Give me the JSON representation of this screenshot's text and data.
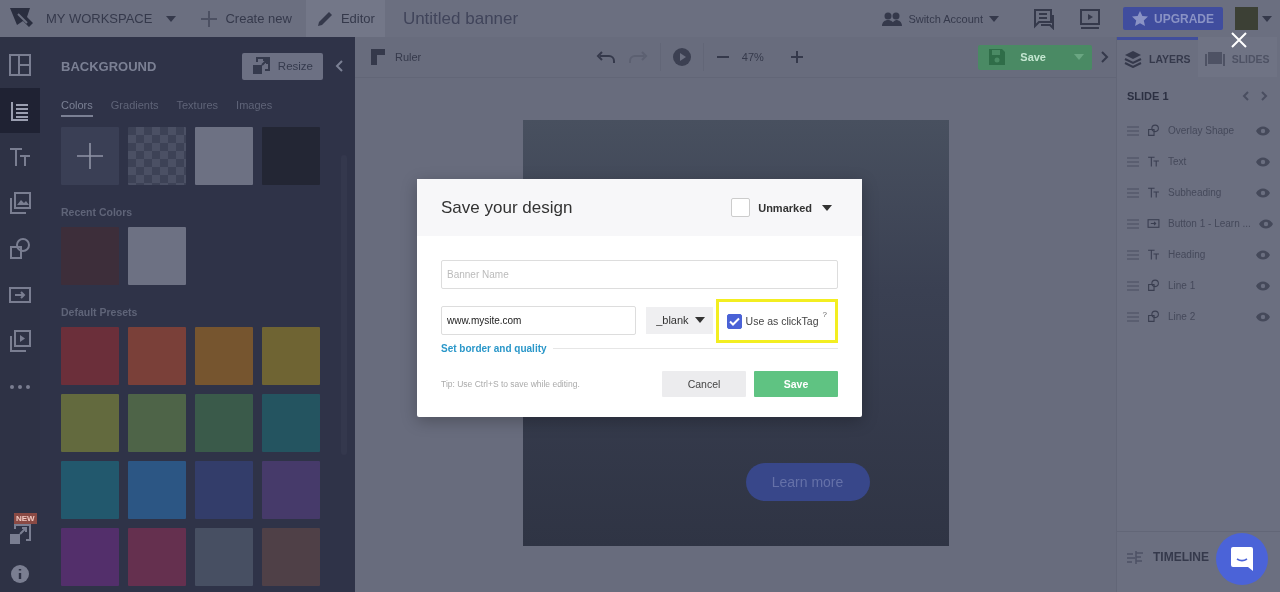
{
  "topbar": {
    "workspace": "MY WORKSPACE",
    "create": "Create new",
    "editor": "Editor",
    "title": "Untitled banner",
    "switch_account": "Switch Account",
    "upgrade": "UPGRADE"
  },
  "rail": [
    {
      "kind": "layout",
      "selected": false
    },
    {
      "kind": "background",
      "selected": true
    },
    {
      "kind": "text",
      "selected": false
    },
    {
      "kind": "image",
      "selected": false
    },
    {
      "kind": "shape",
      "selected": false
    },
    {
      "kind": "button",
      "selected": false
    },
    {
      "kind": "media",
      "selected": false
    },
    {
      "kind": "more",
      "selected": false
    }
  ],
  "rail_bottom": {
    "badge": "NEW"
  },
  "panel": {
    "title": "BACKGROUND",
    "resize": "Resize",
    "tabs": [
      {
        "label": "Colors",
        "selected": true
      },
      {
        "label": "Gradients",
        "selected": false
      },
      {
        "label": "Textures",
        "selected": false
      },
      {
        "label": "Images",
        "selected": false
      }
    ],
    "top_swatches": [
      {
        "kind": "add"
      },
      {
        "kind": "transparent"
      },
      {
        "kind": "color",
        "color": "#6d7183"
      },
      {
        "kind": "color",
        "color": "#232634"
      }
    ],
    "recent_title": "Recent Colors",
    "recent": [
      {
        "color": "#3d2e3a"
      },
      {
        "color": "#6d7183"
      }
    ],
    "presets_title": "Default Presets",
    "presets": [
      {
        "color": "#6b2f3a"
      },
      {
        "color": "#7a4039"
      },
      {
        "color": "#76552f"
      },
      {
        "color": "#6f6433"
      },
      {
        "color": "#636a3e"
      },
      {
        "color": "#4e6448"
      },
      {
        "color": "#3a5a4a"
      },
      {
        "color": "#245460"
      },
      {
        "color": "#22586d"
      },
      {
        "color": "#2c5684"
      },
      {
        "color": "#333d6a"
      },
      {
        "color": "#463a6a"
      },
      {
        "color": "#532f6b"
      },
      {
        "color": "#65304f"
      },
      {
        "color": "#474f62"
      },
      {
        "color": "#4f4047"
      }
    ]
  },
  "toolbar": {
    "ruler": "Ruler",
    "zoom": "47%",
    "save": "Save"
  },
  "canvas": {
    "button": "Learn more"
  },
  "right": {
    "tabs": [
      {
        "label": "LAYERS",
        "selected": true
      },
      {
        "label": "SLIDES",
        "selected": false
      }
    ],
    "slide": "SLIDE 1",
    "layers": [
      {
        "kind": "shape",
        "name": "Overlay Shape"
      },
      {
        "kind": "text",
        "name": "Text"
      },
      {
        "kind": "text",
        "name": "Subheading"
      },
      {
        "kind": "button",
        "name": "Button 1 - Learn ..."
      },
      {
        "kind": "text",
        "name": "Heading"
      },
      {
        "kind": "shape",
        "name": "Line 1"
      },
      {
        "kind": "shape",
        "name": "Line 2"
      }
    ],
    "timeline": "TIMELINE"
  },
  "dialog": {
    "title": "Save your design",
    "marker": {
      "checked": false,
      "label": "Unmarked"
    },
    "name_placeholder": "Banner Name",
    "url": "www.mysite.com",
    "target": "_blank",
    "clicktag": {
      "checked": true,
      "highlighted": true,
      "label": "Use as clickTag",
      "help": "?"
    },
    "link": "Set border and quality",
    "tip": "Tip: Use Ctrl+S to save while editing.",
    "buttons": [
      {
        "kind": "secondary",
        "label": "Cancel"
      },
      {
        "kind": "primary",
        "label": "Save"
      }
    ]
  }
}
